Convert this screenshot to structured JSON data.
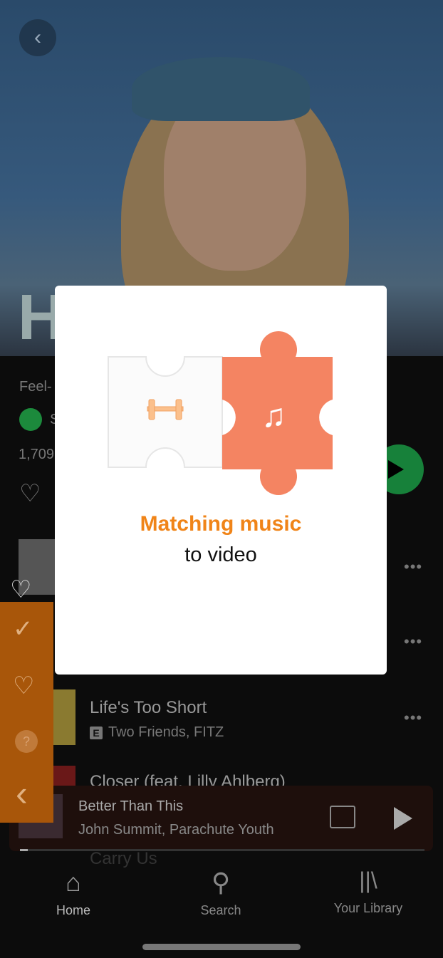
{
  "header": {
    "back": "back-icon"
  },
  "playlist": {
    "title_partial": "H",
    "subtitle_partial": "Feel-",
    "owner_partial": "S",
    "likes_partial": "1,709"
  },
  "tracks": [
    {
      "title": "Life's Too Short",
      "explicit": "E",
      "artist": "Two Friends, FITZ"
    },
    {
      "title": "Closer (feat. Lilly Ahlberg)"
    },
    {
      "title": "Carry Us"
    }
  ],
  "now_playing": {
    "title": "Better Than This",
    "artist": "John Summit, Parachute Youth",
    "progress": 0.02
  },
  "nav": [
    {
      "label": "Home",
      "icon": "home-icon"
    },
    {
      "label": "Search",
      "icon": "search-icon"
    },
    {
      "label": "Your Library",
      "icon": "library-icon"
    }
  ],
  "modal": {
    "line1": "Matching music",
    "line2": "to video",
    "accent": "#f08418",
    "puzzle_color": "#f48462"
  },
  "sidebar": {
    "help": "?",
    "icons": [
      "check-circle-icon",
      "heart-icon",
      "help-icon",
      "chevron-left-icon"
    ]
  }
}
